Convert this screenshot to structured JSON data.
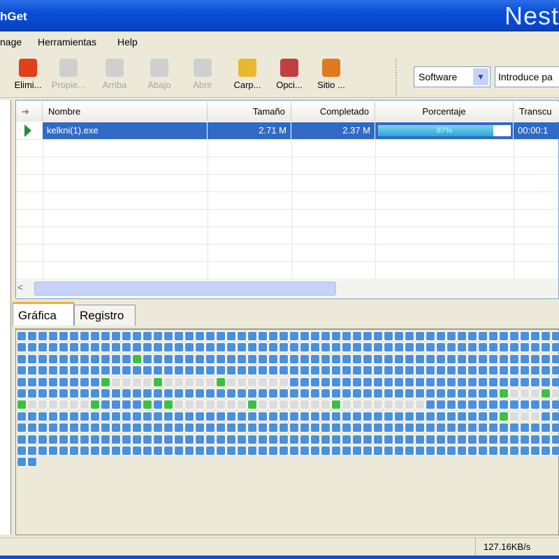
{
  "window": {
    "title": "hGet",
    "brand": "Nest"
  },
  "menu": [
    "nage",
    "Herramientas",
    "Help"
  ],
  "toolbar": [
    {
      "label": "Elimi...",
      "icon": "delete-icon",
      "enabled": true,
      "color": "#e0401a"
    },
    {
      "label": "Propie...",
      "icon": "properties-icon",
      "enabled": false,
      "color": "#cfcfcf"
    },
    {
      "label": "Arriba",
      "icon": "arrow-up-icon",
      "enabled": false,
      "color": "#cfcfcf"
    },
    {
      "label": "Abajo",
      "icon": "arrow-down-icon",
      "enabled": false,
      "color": "#cfcfcf"
    },
    {
      "label": "Abrir",
      "icon": "open-icon",
      "enabled": false,
      "color": "#cfcfcf"
    },
    {
      "label": "Carp...",
      "icon": "folder-icon",
      "enabled": true,
      "color": "#e8b830"
    },
    {
      "label": "Opci...",
      "icon": "options-icon",
      "enabled": true,
      "color": "#c04040"
    },
    {
      "label": "Sitio ...",
      "icon": "site-icon",
      "enabled": true,
      "color": "#e07a20"
    }
  ],
  "category": "Software",
  "search_value": "Introduce pa",
  "columns": [
    "Nombre",
    "Tamaño",
    "Completado",
    "Porcentaje",
    "Transcu"
  ],
  "downloads": [
    {
      "name": "kelkni(1).exe",
      "size": "2.71 M",
      "completed": "2.37 M",
      "percent_label": "87%",
      "percent": 87,
      "elapsed": "00:00:1"
    }
  ],
  "tabs": [
    "Gráfica",
    "Registro"
  ],
  "blocks": [
    "bbbbbbbbbbbbbbbbbbbbbbbbbbbbbbbbbbbbbbbbbbbbbbbbbbbb",
    "bbbbbbbbbbbbbbbbbbbbbbbbbbbbbbbbbbbbbbbbbbbbbbbbbbbb",
    "bbbbbbbbbbbgbbbbbbbbbbbbbbbbbbbbbbbbbbbbbbbbbbbbbbbb",
    "bbbbbbbbbbbbbbbbbbbbbbbbbbbbbbbbbbbbbbbbbbbbbbbbbbbb",
    "bbbbbbbbgwwwwgwwwwwgwwwwwwbbbbbbbbbbbbbbbbbbbbbbbbbb",
    "bbbbbbbbbbbbbbbbbbbbbbbbbbbbbbbbbbbbbbbbbbbbbbgwwwgw",
    "gwwwwwwgbbbbgbgwwwwwwwgwwwwwwwgwwwwwwwwbbbbbbbbbbbbb",
    "bbbbbbbbbbbbbbbbbbbbbbbbbbbbbbbbbbbbbbbbbbbbbbgwwwbb",
    "bbbbbbbbbbbbbbbbbbbbbbbbbbbbbbbbbbbbbbbbbbbbbbbbbbbb",
    "bbbbbbbbbbbbbbbbbbbbbbbbbbbbbbbbbbbbbbbbbbbbbbbbbbbb",
    "bbbbbbbbbbbbbbbbbbbbbbbbbbbbbbbbbbbbbbbbbbbbbbbbbbbb",
    "bb"
  ],
  "colors": {
    "done": "#4a90dc",
    "active": "#3cc043",
    "pending": "#dcdcdc"
  },
  "status": {
    "speed": "127.16KB/s"
  }
}
